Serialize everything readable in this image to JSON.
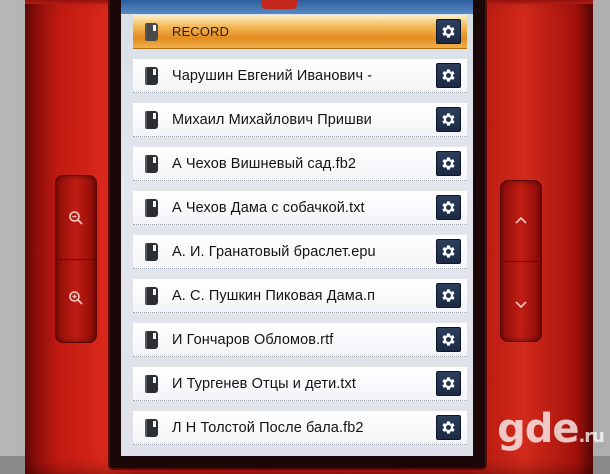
{
  "colors": {
    "device": "#c11a12",
    "selected_row": "#f0a93e",
    "gear_button": "#22324f"
  },
  "file_list": {
    "items": [
      {
        "label": "RECORD",
        "icon": "folder-icon",
        "selected": true
      },
      {
        "label": "Чарушин Евгений Иванович -",
        "icon": "folder-icon",
        "selected": false
      },
      {
        "label": "Михаил Михайлович Пришви",
        "icon": "folder-icon",
        "selected": false
      },
      {
        "label": "А Чехов  Вишневый сад.fb2",
        "icon": "book-icon",
        "selected": false
      },
      {
        "label": "А Чехов  Дама с собачкой.txt",
        "icon": "book-icon",
        "selected": false
      },
      {
        "label": "А. И. Гранатовый браслет.epu",
        "icon": "book-icon",
        "selected": false
      },
      {
        "label": "А. С. Пушкин Пиковая Дама.п",
        "icon": "book-icon",
        "selected": false
      },
      {
        "label": "И Гончаров Обломов.rtf",
        "icon": "book-icon",
        "selected": false
      },
      {
        "label": "И Тургенев Отцы и дети.txt",
        "icon": "book-icon",
        "selected": false
      },
      {
        "label": "Л Н Толстой После бала.fb2",
        "icon": "book-icon",
        "selected": false
      }
    ]
  },
  "side_buttons": {
    "zoom_out": "zoom-out-icon",
    "zoom_in": "zoom-in-icon",
    "page_up": "chevron-up-icon",
    "page_down": "chevron-down-icon"
  },
  "watermark": {
    "text": "gde",
    "suffix": ".ru"
  }
}
